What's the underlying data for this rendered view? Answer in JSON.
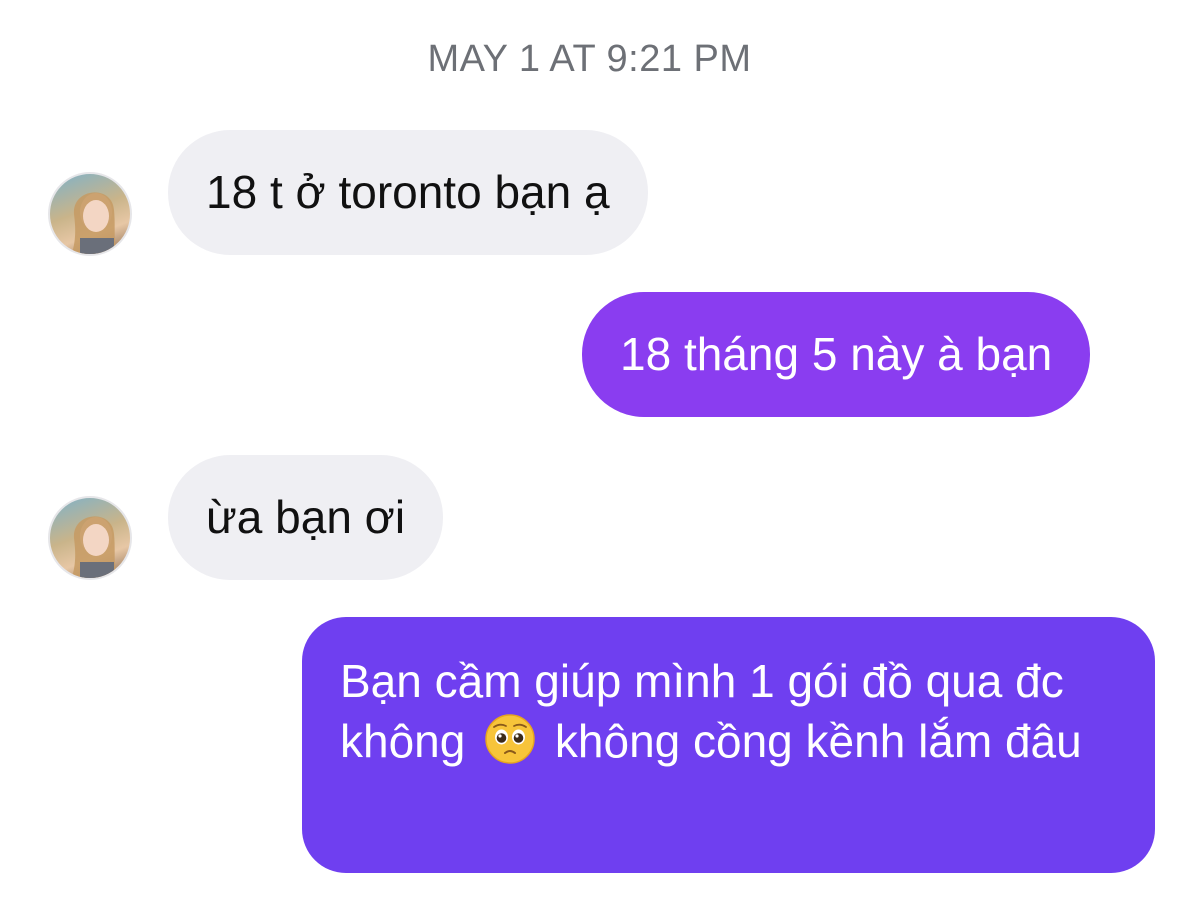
{
  "timestamp": "MAY 1 AT 9:21 PM",
  "messages": [
    {
      "direction": "incoming",
      "text": "18 t ở toronto bạn ạ"
    },
    {
      "direction": "outgoing",
      "text": "18 tháng 5 này à bạn"
    },
    {
      "direction": "incoming",
      "text": "ừa bạn ơi"
    },
    {
      "direction": "outgoing",
      "text_before_emoji": "Bạn cầm giúp mình 1 gói đồ qua đc không",
      "emoji": "pleading-face-emoji",
      "text_after_emoji": "không cồng kềnh lắm đâu"
    }
  ],
  "colors": {
    "incoming_bubble": "#efeff3",
    "outgoing_bubble_top": "#8a3df0",
    "outgoing_bubble_bottom": "#6f3ff0",
    "timestamp_text": "#6d7076"
  }
}
